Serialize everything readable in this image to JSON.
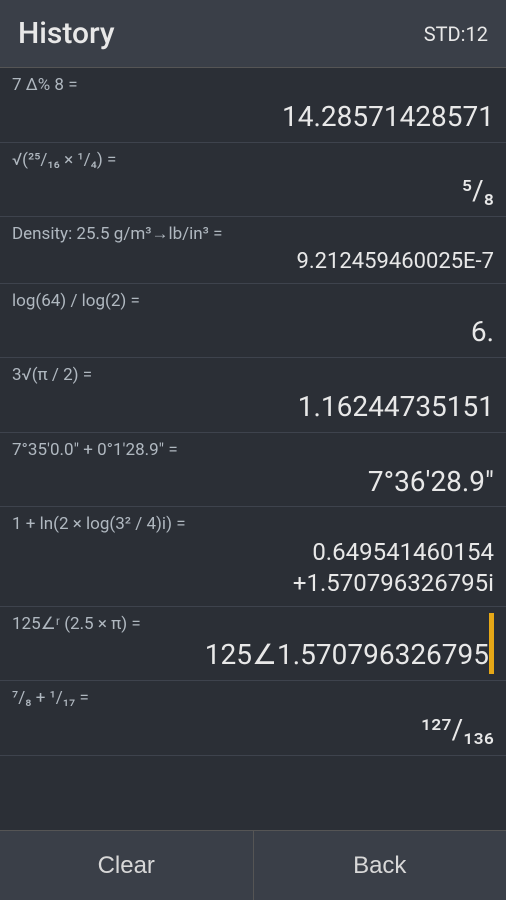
{
  "header": {
    "title": "History",
    "std_label": "STD:12"
  },
  "entries": [
    {
      "id": 1,
      "expression": "7 Δ% 8 =",
      "result": "14.28571428571",
      "result_size": "normal",
      "bar_color": ""
    },
    {
      "id": 2,
      "expression": "√(²⁵/₁₆ × ¹/₄) =",
      "result": "⁵/₈",
      "result_size": "normal",
      "bar_color": ""
    },
    {
      "id": 3,
      "expression": "Density: 25.5 g/m³→lb/in³ =",
      "result": "9.212459460025E-7",
      "result_size": "smaller",
      "bar_color": ""
    },
    {
      "id": 4,
      "expression": "log(64) / log(2) =",
      "result": "6.",
      "result_size": "normal",
      "bar_color": ""
    },
    {
      "id": 5,
      "expression": "3√(π / 2) =",
      "result": "1.16244735151",
      "result_size": "normal",
      "bar_color": ""
    },
    {
      "id": 6,
      "expression": "7°35'0.0\" + 0°1'28.9\" =",
      "result": "7°36'28.9\"",
      "result_size": "normal",
      "bar_color": ""
    },
    {
      "id": 7,
      "expression": "1 + ln(2 × log(3² / 4)i) =",
      "result_line1": "0.649541460154",
      "result_line2": "+1.570796326795i",
      "result_size": "multi",
      "bar_color": ""
    },
    {
      "id": 8,
      "expression": "125∠ʳ (2.5 × π) =",
      "result": "125∠1.570796326795",
      "result_size": "normal",
      "bar_color": "#e6a817"
    },
    {
      "id": 9,
      "expression": "⁷/₈ + ¹/₁₇ =",
      "result": "¹²⁷/₁₃₆",
      "result_size": "normal",
      "bar_color": ""
    }
  ],
  "footer": {
    "clear_label": "Clear",
    "back_label": "Back"
  }
}
